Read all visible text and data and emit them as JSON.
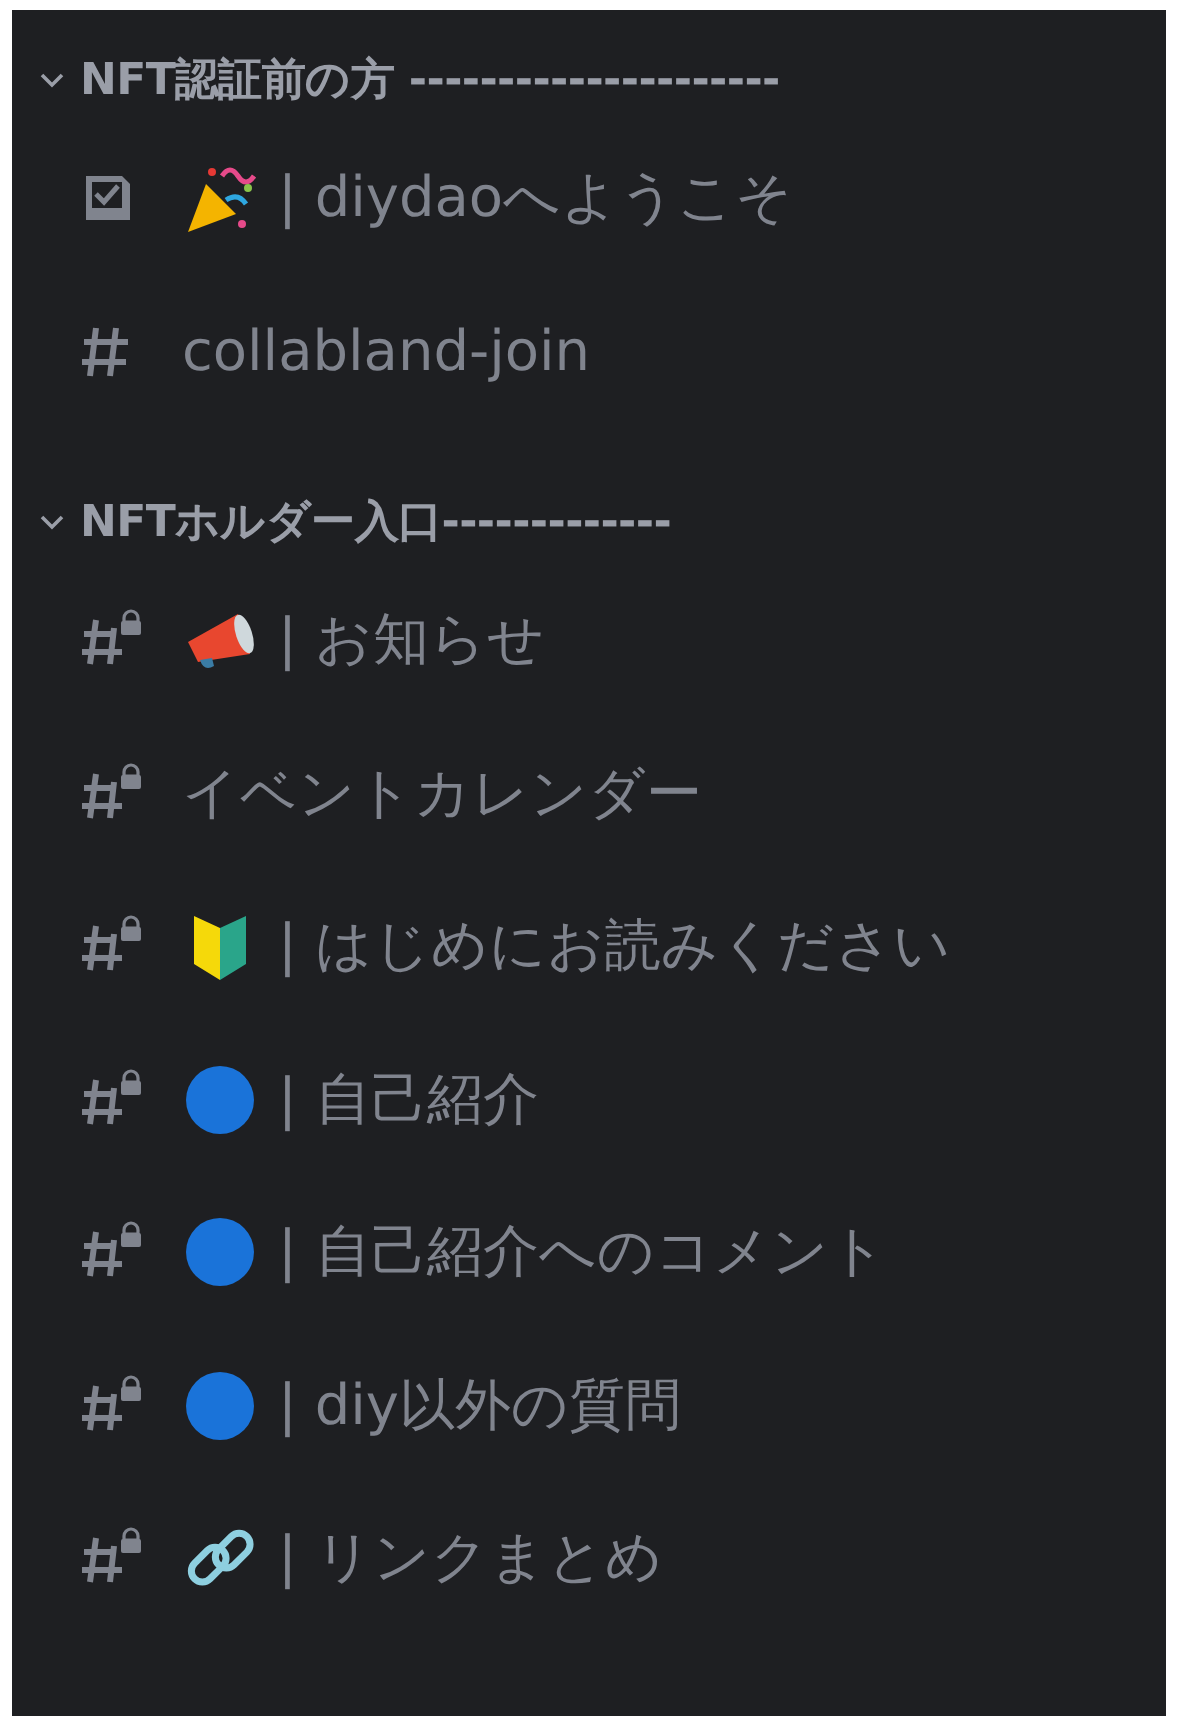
{
  "categories": [
    {
      "title": "NFT認証前の方 ---------------------",
      "expanded": true,
      "channels": [
        {
          "kind": "rules",
          "emoji": {
            "kind": "party"
          },
          "name": "| diydaoへようこそ"
        },
        {
          "kind": "text",
          "name": "collabland-join"
        }
      ]
    },
    {
      "title": "NFTホルダー入口-------------",
      "expanded": true,
      "channels": [
        {
          "kind": "locked",
          "emoji": {
            "kind": "megaphone"
          },
          "name": "| お知らせ"
        },
        {
          "kind": "locked",
          "name": "イベントカレンダー"
        },
        {
          "kind": "locked",
          "emoji": {
            "kind": "beginner"
          },
          "name": "| はじめにお読みください"
        },
        {
          "kind": "locked",
          "emoji": {
            "kind": "circle"
          },
          "name": "| 自己紹介"
        },
        {
          "kind": "locked",
          "emoji": {
            "kind": "circle"
          },
          "name": "| 自己紹介へのコメント"
        },
        {
          "kind": "locked",
          "emoji": {
            "kind": "circle"
          },
          "name": "| diy以外の質問"
        },
        {
          "kind": "locked",
          "emoji": {
            "kind": "link"
          },
          "name": "| リンクまとめ"
        }
      ]
    }
  ]
}
